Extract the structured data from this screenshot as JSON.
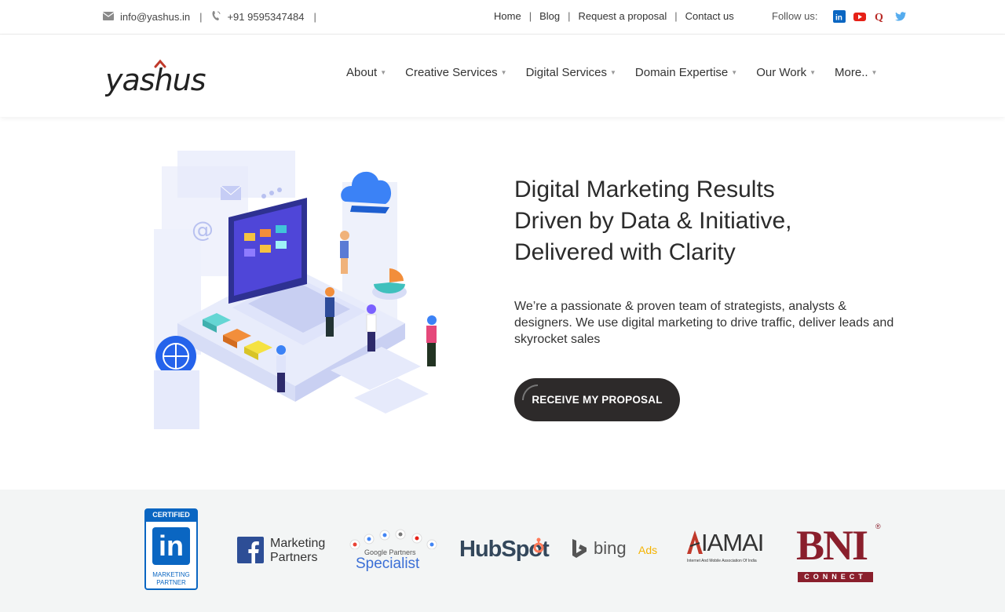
{
  "topbar": {
    "email": "info@yashus.in",
    "phone": "+91 9595347484",
    "links": [
      "Home",
      "Blog",
      "Request a proposal",
      "Contact us"
    ],
    "follow_label": "Follow us:",
    "social_icons": [
      "linkedin-icon",
      "youtube-icon",
      "quora-icon",
      "twitter-icon"
    ]
  },
  "logo": {
    "text": "yashus"
  },
  "nav": {
    "items": [
      "About",
      "Creative Services",
      "Digital Services",
      "Domain Expertise",
      "Our Work",
      "More.."
    ]
  },
  "hero": {
    "headline_lines": [
      "Digital Marketing Results",
      "Driven by Data & Initiative,",
      "Delivered with Clarity"
    ],
    "description": "We’re a passionate & proven team of strategists, analysts & designers. We use digital marketing to drive traffic, deliver leads and skyrocket sales",
    "cta": "RECEIVE MY PROPOSAL"
  },
  "partners": {
    "linkedin": {
      "top": "CERTIFIED",
      "mark": "in",
      "bottom1": "MARKETING",
      "bottom2": "PARTNER"
    },
    "facebook": {
      "line1": "Marketing",
      "line2": "Partners"
    },
    "google": {
      "line1": "Google Partners",
      "line2": "Specialist"
    },
    "hubspot": {
      "text": "HubSpot"
    },
    "bing": {
      "brand": "bing",
      "suffix": "Ads"
    },
    "iamai": {
      "text": "IAMAI",
      "sub": "Internet And Mobile Association Of India"
    },
    "bni": {
      "text": "BNI",
      "sub": "CONNECT"
    }
  },
  "colors": {
    "accent_red": "#c0392b",
    "cta_bg": "#2d2a2a",
    "linkedin": "#0a66c2",
    "youtube": "#e62117",
    "twitter": "#55acee",
    "bni": "#8a1f2c"
  }
}
